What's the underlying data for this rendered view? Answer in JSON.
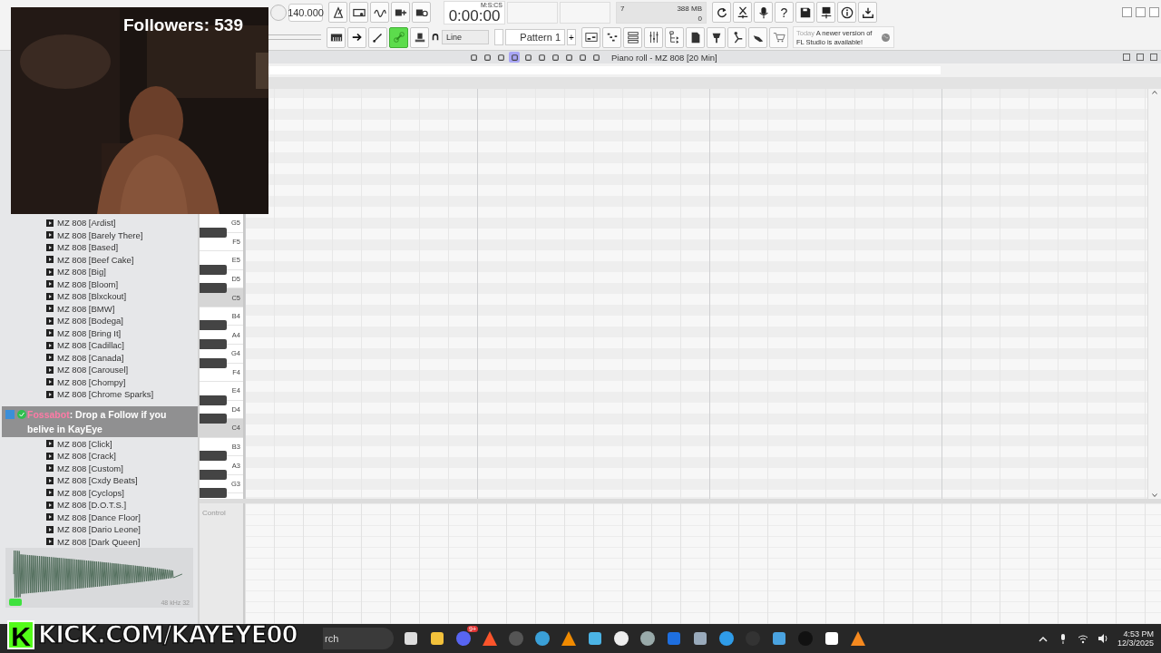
{
  "webcam": {
    "kind": "picture",
    "followers": "Followers: 539"
  },
  "toolbar": {
    "tempo": "140.000",
    "time": "0:00:00",
    "time_unit": "M:S:CS",
    "cpu": "7",
    "memory": "388 MB",
    "polyphony": "0",
    "help": "?",
    "snap": "Line",
    "pattern": "Pattern 1",
    "pattern_add": "+",
    "link_on": true,
    "news_date": "Today",
    "news": "A newer version of FL Studio is available!"
  },
  "piano_roll": {
    "title": "Piano roll - MZ 808 [20 Min]",
    "tools": [
      {
        "selected": false
      },
      {
        "selected": false
      },
      {
        "selected": false
      },
      {
        "selected": true
      },
      {
        "selected": false
      },
      {
        "selected": false
      },
      {
        "selected": false
      },
      {
        "selected": false
      },
      {
        "selected": false
      },
      {
        "selected": false
      }
    ],
    "keys": [
      {
        "label": "G5",
        "black_key": true,
        "highlighted": false
      },
      {
        "label": "F5",
        "black_key": false,
        "highlighted": false
      },
      {
        "label": "E5",
        "black_key": true,
        "highlighted": false
      },
      {
        "label": "D5",
        "black_key": true,
        "highlighted": false
      },
      {
        "label": "C5",
        "black_key": false,
        "highlighted": true
      },
      {
        "label": "B4",
        "black_key": true,
        "highlighted": false
      },
      {
        "label": "A4",
        "black_key": true,
        "highlighted": false
      },
      {
        "label": "G4",
        "black_key": true,
        "highlighted": false
      },
      {
        "label": "F4",
        "black_key": false,
        "highlighted": false
      },
      {
        "label": "E4",
        "black_key": true,
        "highlighted": false
      },
      {
        "label": "D4",
        "black_key": true,
        "highlighted": false
      },
      {
        "label": "C4",
        "black_key": false,
        "highlighted": true
      },
      {
        "label": "B3",
        "black_key": true,
        "highlighted": false
      },
      {
        "label": "A3",
        "black_key": true,
        "highlighted": false
      },
      {
        "label": "G3",
        "black_key": true,
        "highlighted": false
      }
    ],
    "control_label": "Control"
  },
  "browser": {
    "items_above": [
      "MZ 808 [Ardist]",
      "MZ 808 [Barely There]",
      "MZ 808 [Based]",
      "MZ 808 [Beef Cake]",
      "MZ 808 [Big]",
      "MZ 808 [Bloom]",
      "MZ 808 [Blxckout]",
      "MZ 808 [BMW]",
      "MZ 808 [Bodega]",
      "MZ 808 [Bring It]",
      "MZ 808 [Cadillac]",
      "MZ 808 [Canada]",
      "MZ 808 [Carousel]",
      "MZ 808 [Chompy]",
      "MZ 808 [Chrome Sparks]"
    ],
    "items_below": [
      "MZ 808 [Click]",
      "MZ 808 [Crack]",
      "MZ 808 [Custom]",
      "MZ 808 [Cxdy Beats]",
      "MZ 808 [Cyclops]",
      "MZ 808 [D.O.T.S.]",
      "MZ 808 [Dance Floor]",
      "MZ 808 [Dario Leone]",
      "MZ 808 [Dark Queen]"
    ],
    "sample_info": "48 kHz 32"
  },
  "chat": {
    "user": "Fossabot",
    "message": ": Drop a Follow if you belive in KayEye"
  },
  "banner": {
    "logo": "K",
    "text": "KICK.COM/KAYEYE00"
  },
  "taskbar": {
    "search": "rch",
    "badge": "9+",
    "time": "4:53 PM",
    "date": "12/3/2025"
  }
}
